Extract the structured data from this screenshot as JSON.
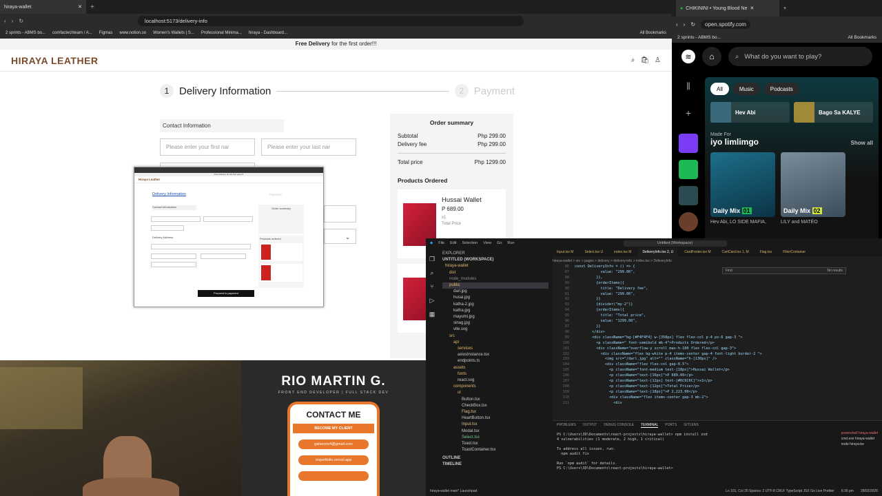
{
  "left_browser": {
    "tab_title": "hiraya-wallet",
    "url": "localhost:5173/delivery-info",
    "bookmarks": [
      "2 sprints - ABMS bo...",
      "comfactechteam / A...",
      "Figmas",
      "www.notion.so",
      "Women's Wallets | S...",
      "Professional Minima...",
      "hiraya - Dashboard...",
      "All Bookmarks"
    ],
    "promo_bold": "Free Delivery",
    "promo_rest": " for the first order!!!",
    "brand": "HIRAYA LEATHER",
    "step1_num": "1",
    "step1_label": "Delivery Information",
    "step2_num": "2",
    "step2_label": "Payment",
    "contact_section": "Contact Information",
    "first_name_placeholder": "Please enter your first nar",
    "last_name_placeholder": "Please enter your last nar",
    "summary": {
      "title": "Order summary",
      "subtotal_label": "Subtotal",
      "subtotal_value": "Php 299.00",
      "delivery_label": "Delivery fee",
      "delivery_value": "Php 299.00",
      "total_label": "Total price",
      "total_value": "Php 1299.00",
      "products_title": "Products Ordered",
      "product_name": "Hussai Wallet",
      "product_price": "P 689.00",
      "product_qty": "x1",
      "product_total_label": "Total Price"
    },
    "mini": {
      "promo": "Free delivery for the first order!!!",
      "brand": "Hiraya Leather",
      "step": "Delivery Information",
      "step2": "Payment",
      "contact": "Contact Information",
      "delivery_address": "Delivery Address",
      "order_summary": "Order summary",
      "products": "Products ordered",
      "proceed": "Proceed to payment"
    }
  },
  "spotify": {
    "tab_title": "CHIKININI • Young Blood Ne",
    "url": "open.spotify.com",
    "bookmarks": [
      "2 sprints - ABMS bo...",
      "All Bookmarks"
    ],
    "search_placeholder": "What do you want to play?",
    "chips": [
      "All",
      "Music",
      "Podcasts"
    ],
    "quick": [
      "Hev Abi",
      "Bago Sa KALYE"
    ],
    "made_for": "Made For",
    "user": "iyo limlimgo",
    "show_all": "Show all",
    "mixes": [
      {
        "label": "Daily Mix",
        "num": "01",
        "caption": "Hev Abi, LO SIDE MAFIA,"
      },
      {
        "label": "Daily Mix",
        "num": "02",
        "caption": "LILY and MATÉO"
      }
    ]
  },
  "banner": {
    "name": "RIO MARTIN G.",
    "role": "FRONT END DEVELOPER | FULL STACK DEV",
    "contact": "CONTACT ME",
    "client_btn": "BECOME MY CLIENT",
    "email": "galvezrio4@gmail.com",
    "portfolio": "rioportfolio.vercel.app"
  },
  "vscode": {
    "title": "Untitled (Workspace)",
    "menu": [
      "File",
      "Edit",
      "Selection",
      "View",
      "Go",
      "Run"
    ],
    "explorer_title": "EXPLORER",
    "workspace": "UNTITLED (WORKSPACE)",
    "tree": [
      "hiraya-wallet",
      "dist",
      "node_modules",
      "public",
      "darl.jpg",
      "husai.jpg",
      "katha-2.jpg",
      "katha.jpg",
      "mayumi.jpg",
      "sinag.jpg",
      "vite.svg",
      "src",
      "api",
      "services",
      "axiosInstance.tsx",
      "endpoints.ts",
      "assets",
      "fonts",
      "react.svg",
      "components",
      "ui",
      "Button.tsx",
      "CheckBox.tsx",
      "Flag.tsx",
      "HeartButton.tsx",
      "Input.tsx",
      "Modal.tsx",
      "Select.tsx",
      "Toast.tsx",
      "ToastContainer.tsx"
    ],
    "outline": "OUTLINE",
    "timeline": "TIMELINE",
    "tabs": [
      "Input.tsx M",
      "Select.tsx U",
      "index.tsx M",
      "DeliveryInfo.tsx 2, U",
      "CardFooter.tsx M",
      "CartCard.tsx 1, M",
      "Flag.tsx",
      "FilterContainer"
    ],
    "breadcrumb": "hiraya-wallet > src > pages > delivery > delivery-info > index.tsx > DeliveryInfo",
    "find_text": "Find",
    "find_result": "No results",
    "code_lines": [
      {
        "n": "86",
        "t": "const DeliveryInfo = () => {"
      },
      {
        "n": "87",
        "t": "            value: \"299.00\","
      },
      {
        "n": "88",
        "t": "          }},"
      },
      {
        "n": "89",
        "t": "          {orderItems({"
      },
      {
        "n": "90",
        "t": "            title: \"Delivery fee\","
      },
      {
        "n": "91",
        "t": "            value: \"299.00\","
      },
      {
        "n": "92",
        "t": "          }}"
      },
      {
        "n": "93",
        "t": "          {divider(\"my-2\")}"
      },
      {
        "n": "94",
        "t": "          {orderItems({"
      },
      {
        "n": "95",
        "t": "            title: \"Total price\","
      },
      {
        "n": "96",
        "t": "            value: \"1299.00\","
      },
      {
        "n": "97",
        "t": "          }}"
      },
      {
        "n": "98",
        "t": "        </div>"
      },
      {
        "n": "99",
        "t": "        <div className=\"bg-[#F4F4F4] w-[358px] flex flex-col p-4 px-6 gap-3 \">"
      },
      {
        "n": "100",
        "t": "          <p className=\" font-semibold mb-4\">Products Ordered</p>"
      },
      {
        "n": "101",
        "t": "          <div className=\"overflow-y scroll max-h-100 flex flex-col gap-3\">"
      },
      {
        "n": "102",
        "t": "            <div className=\"flex bg-white p-4 items-center gap-4 font-light border-2 \">"
      },
      {
        "n": "103",
        "t": "              <img src=\"/darl.jpg\" alt=\"\" className=\"h-[130px]\" />"
      },
      {
        "n": "104",
        "t": "              <div className=\"flex flex-col gap-0.5\">"
      },
      {
        "n": "105",
        "t": "                <p className=\"font-medium text-[18px]\">Hussai Wallet</p>"
      },
      {
        "n": "106",
        "t": "                <p className=\"text-[16px]\">P 689.00</p>"
      },
      {
        "n": "107",
        "t": "                <p className=\"text-[12px] text-[#6C6C6C]\">x1</p>"
      },
      {
        "n": "108",
        "t": "                <p className=\"text-[12px]\">Total Price</p>"
      },
      {
        "n": "109",
        "t": "                <p className=\"text-[18px]\">P 2,223.00</p>"
      },
      {
        "n": "110",
        "t": "                <div className=\"flex items-center gap-3 mb-2\">"
      },
      {
        "n": "111",
        "t": "                  <div"
      }
    ],
    "panel_tabs": [
      "PROBLEMS",
      "OUTPUT",
      "DEBUG CONSOLE",
      "TERMINAL",
      "PORTS",
      "GITLENS"
    ],
    "terminal": [
      "PS C:\\Users\\3D\\Documents\\react-projects\\hiraya-wallet> npm install zod",
      "4 vulnerabilities (1 moderate, 2 high, 1 critical)",
      "",
      "To address all issues, run:",
      "  npm audit fix",
      "",
      "Run `npm audit` for details.",
      "PS C:\\Users\\3D\\Documents\\react-projects\\hiraya-wallet>"
    ],
    "terminals": [
      "powershell hiraya-wallet",
      "cmd.exe hiraya-wallet",
      "node hiraya-be"
    ],
    "status_left": "hiraya-wallet   main*   Launchpad",
    "status_right": "Ln 101, Col 20   Spaces: 2   UTF-8   CRLF   TypeScript JSX   Go Live   Prettier",
    "clock": "6:36 pm",
    "date": "28/02/2026"
  }
}
